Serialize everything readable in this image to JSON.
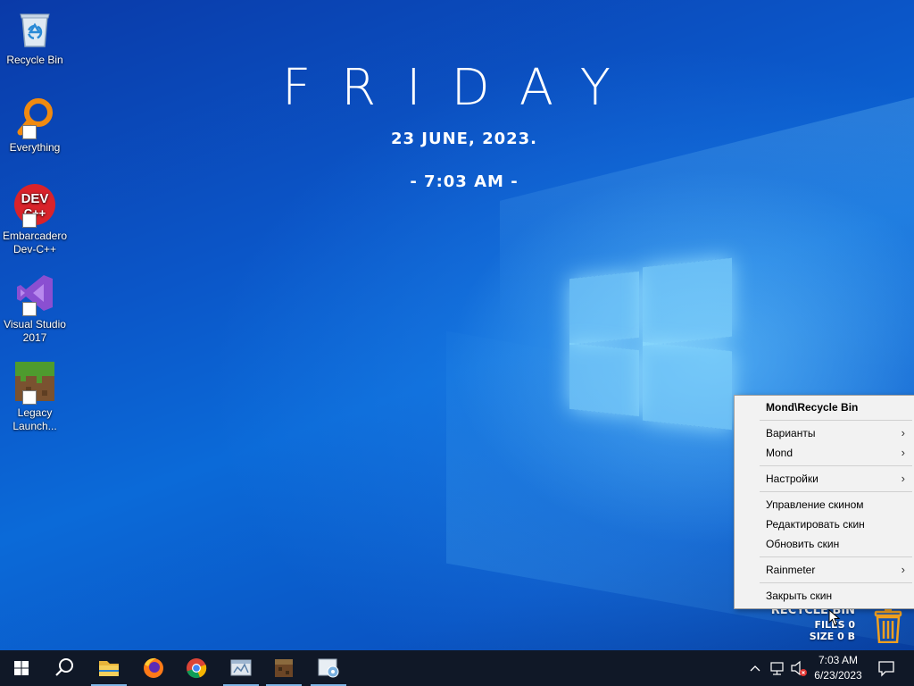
{
  "desktop": {
    "icons": [
      {
        "label": "Recycle Bin",
        "icon": "recycle-bin-icon"
      },
      {
        "label": "Everything",
        "icon": "everything-search-icon"
      },
      {
        "label": "Embarcadero Dev-C++",
        "icon": "devcpp-icon"
      },
      {
        "label": "Visual Studio 2017",
        "icon": "visual-studio-icon"
      },
      {
        "label": "Legacy Launch...",
        "icon": "minecraft-grass-block-icon"
      }
    ]
  },
  "clock_widget": {
    "day": "FRIDAY",
    "date": "23  JUNE,  2023.",
    "time": "- 7:03 AM -"
  },
  "recycle_bin_skin": {
    "title": "RECYCLE BIN",
    "files": "FILES 0",
    "size": "SIZE 0 B",
    "icon": "trash-can-icon"
  },
  "context_menu": {
    "header": "Mond\\Recycle Bin",
    "items": [
      {
        "label": "Варианты",
        "submenu": true
      },
      {
        "label": "Mond",
        "submenu": true
      },
      {
        "label": "Настройки",
        "submenu": true
      },
      {
        "label": "Управление скином",
        "submenu": false
      },
      {
        "label": "Редактировать скин",
        "submenu": false
      },
      {
        "label": "Обновить скин",
        "submenu": false
      },
      {
        "label": "Rainmeter",
        "submenu": true
      },
      {
        "label": "Закрыть скин",
        "submenu": false
      }
    ]
  },
  "taskbar": {
    "buttons": [
      {
        "name": "start",
        "icon": "windows-logo-icon"
      },
      {
        "name": "search",
        "icon": "search-icon"
      },
      {
        "name": "file-explorer",
        "icon": "folder-icon"
      },
      {
        "name": "firefox",
        "icon": "firefox-icon"
      },
      {
        "name": "chrome",
        "icon": "chrome-icon"
      },
      {
        "name": "app-window",
        "icon": "app-window-icon"
      },
      {
        "name": "legacy-launcher",
        "icon": "minecraft-block-icon"
      },
      {
        "name": "settings-app",
        "icon": "settings-app-icon"
      }
    ],
    "tray": {
      "time": "7:03 AM",
      "date": "6/23/2023"
    }
  },
  "colors": {
    "taskbar": "#101827",
    "desktop_blue": "#0b56c8",
    "menu_bg": "#f2f2f2",
    "trash_orange": "#f0a020"
  }
}
